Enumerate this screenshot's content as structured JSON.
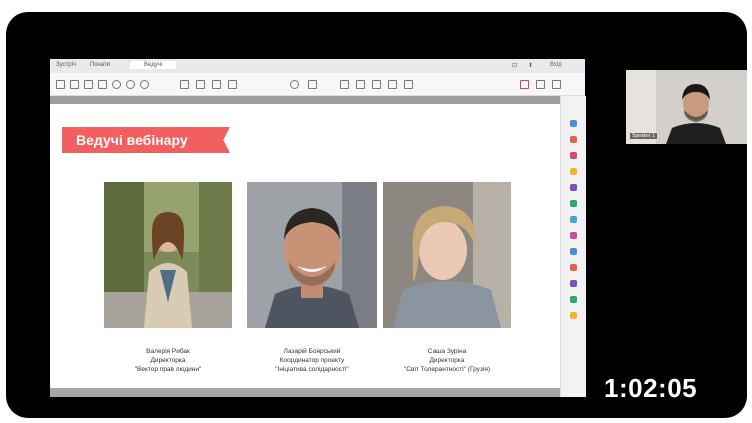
{
  "browser": {
    "tabs": [
      "Зустріч",
      "Почати",
      "Ведучі"
    ],
    "controls": [
      "⊡",
      "⬆",
      "Вхід"
    ]
  },
  "slide": {
    "banner_title": "Ведучі вебінару",
    "hosts": [
      {
        "name": "Валерія Рибак",
        "role": "Директорка",
        "org": "\"Вектор прав людини\""
      },
      {
        "name": "Лазарій Боярський",
        "role": "Координатор проекту",
        "org": "\"Ініціатива солідарності\""
      },
      {
        "name": "Саша Зуріна",
        "role": "Директорка",
        "org": "\"Світ Толерантності\" (Грузія)"
      }
    ]
  },
  "webcam": {
    "name_tag": "Speaker 1"
  },
  "video": {
    "duration": "1:02:05"
  },
  "colors": {
    "banner": "#f25f5f",
    "frame": "#000000"
  }
}
